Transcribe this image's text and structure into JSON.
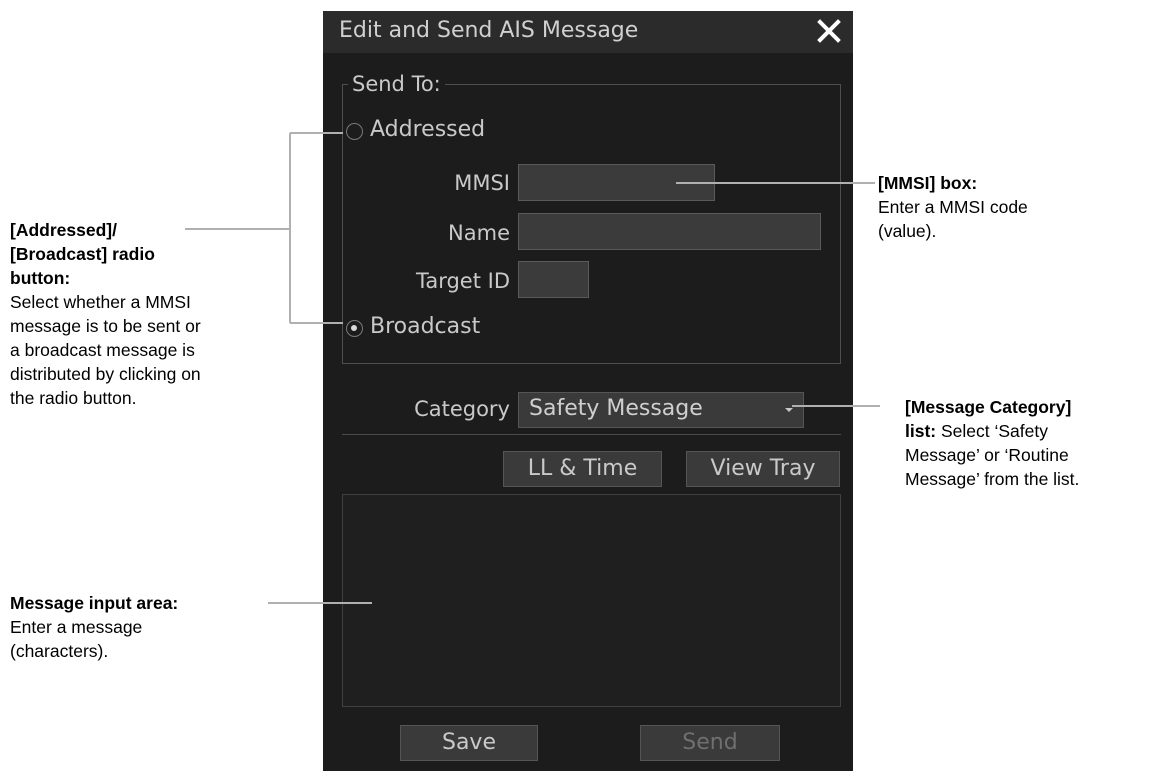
{
  "dialog": {
    "title": "Edit and Send AIS Message",
    "close_icon": "close-icon",
    "send_to": {
      "legend": "Send To:",
      "addressed_label": "Addressed",
      "broadcast_label": "Broadcast",
      "selected": "Broadcast",
      "mmsi_label": "MMSI",
      "mmsi_value": "",
      "name_label": "Name",
      "name_value": "",
      "target_id_label": "Target ID",
      "target_id_value": ""
    },
    "category": {
      "label": "Category",
      "value": "Safety Message"
    },
    "buttons": {
      "ll_time": "LL & Time",
      "view_tray": "View Tray",
      "save": "Save",
      "send": "Send"
    },
    "message_text": ""
  },
  "callouts": {
    "radio": {
      "title_1": "[Addressed]/",
      "title_2": "[Broadcast] radio",
      "title_3": "button:",
      "body_1": "Select whether a MMSI",
      "body_2": "message is to be sent or",
      "body_3": "a broadcast message is",
      "body_4": "distributed by clicking on",
      "body_5": "the radio button."
    },
    "mmsi": {
      "title": "[MMSI] box:",
      "body_1": "Enter a MMSI code",
      "body_2": "(value)."
    },
    "category": {
      "title_1": "[Message Category]",
      "title_2": "list:",
      "body_1": " Select ‘Safety",
      "body_2": "Message’ or ‘Routine",
      "body_3": "Message’ from the list."
    },
    "message_area": {
      "title": "Message input area:",
      "body_1": "Enter a message",
      "body_2": "(characters)."
    }
  },
  "colors": {
    "dialog_bg": "#1c1c1c",
    "titlebar_bg": "#2b2b2b",
    "text": "#c9c9c9",
    "field_bg": "#3b3b3b",
    "leader_line": "#b0b0b0"
  }
}
